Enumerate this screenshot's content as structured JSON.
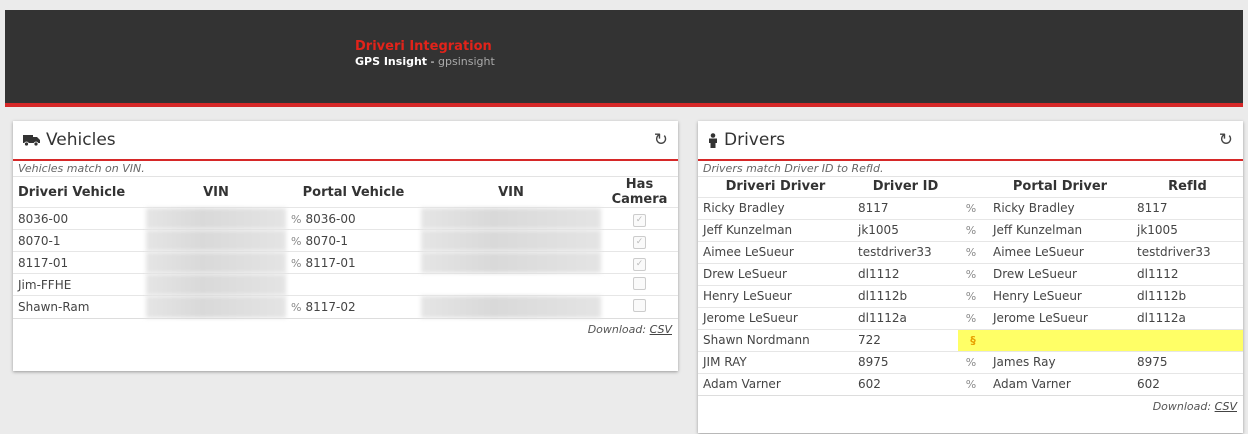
{
  "header": {
    "title": "Driveri Integration",
    "subtitle_bold": "GPS Insight",
    "subtitle_sep": " - ",
    "subtitle_account": "gpsinsight"
  },
  "vehicles": {
    "title": "Vehicles",
    "note": "Vehicles match on VIN.",
    "columns": [
      "Driveri Vehicle",
      "VIN",
      "Portal Vehicle",
      "VIN",
      "Has Camera"
    ],
    "rows": [
      {
        "driveri": "8036-00",
        "portal": "8036-00",
        "linked": true,
        "has_camera": true
      },
      {
        "driveri": "8070-1",
        "portal": "8070-1",
        "linked": true,
        "has_camera": true
      },
      {
        "driveri": "8117-01",
        "portal": "8117-01",
        "linked": true,
        "has_camera": true
      },
      {
        "driveri": "Jim-FFHE",
        "portal": "",
        "linked": false,
        "has_camera": false
      },
      {
        "driveri": "Shawn-Ram",
        "portal": "8117-02",
        "linked": true,
        "has_camera": false
      }
    ],
    "download_label": "Download:",
    "download_link": "CSV"
  },
  "drivers": {
    "title": "Drivers",
    "note": "Drivers match Driver ID to RefId.",
    "columns": [
      "Driveri Driver",
      "Driver ID",
      "Portal Driver",
      "RefId"
    ],
    "rows": [
      {
        "name": "Ricky Bradley",
        "id": "8117",
        "portal": "Ricky Bradley",
        "ref": "8117",
        "status": "linked"
      },
      {
        "name": "Jeff Kunzelman",
        "id": "jk1005",
        "portal": "Jeff Kunzelman",
        "ref": "jk1005",
        "status": "linked"
      },
      {
        "name": "Aimee LeSueur",
        "id": "testdriver33",
        "portal": "Aimee LeSueur",
        "ref": "testdriver33",
        "status": "linked"
      },
      {
        "name": "Drew LeSueur",
        "id": "dl1112",
        "portal": "Drew LeSueur",
        "ref": "dl1112",
        "status": "linked"
      },
      {
        "name": "Henry LeSueur",
        "id": "dl1112b",
        "portal": "Henry LeSueur",
        "ref": "dl1112b",
        "status": "linked"
      },
      {
        "name": "Jerome LeSueur",
        "id": "dl1112a",
        "portal": "Jerome LeSueur",
        "ref": "dl1112a",
        "status": "linked"
      },
      {
        "name": "Shawn Nordmann",
        "id": "722",
        "portal": "",
        "ref": "",
        "status": "unlinked"
      },
      {
        "name": "JIM RAY",
        "id": "8975",
        "portal": "James Ray",
        "ref": "8975",
        "status": "linked"
      },
      {
        "name": "Adam Varner",
        "id": "602",
        "portal": "Adam Varner",
        "ref": "602",
        "status": "linked"
      }
    ],
    "download_label": "Download:",
    "download_link": "CSV"
  },
  "icons": {
    "vehicles": "truck-icon",
    "drivers": "person-icon",
    "refresh": "refresh-icon",
    "link": "link-icon",
    "broken_link": "broken-link-icon"
  },
  "colors": {
    "accent": "#d62828",
    "header_bg": "#333333",
    "highlight": "#ffff66"
  }
}
